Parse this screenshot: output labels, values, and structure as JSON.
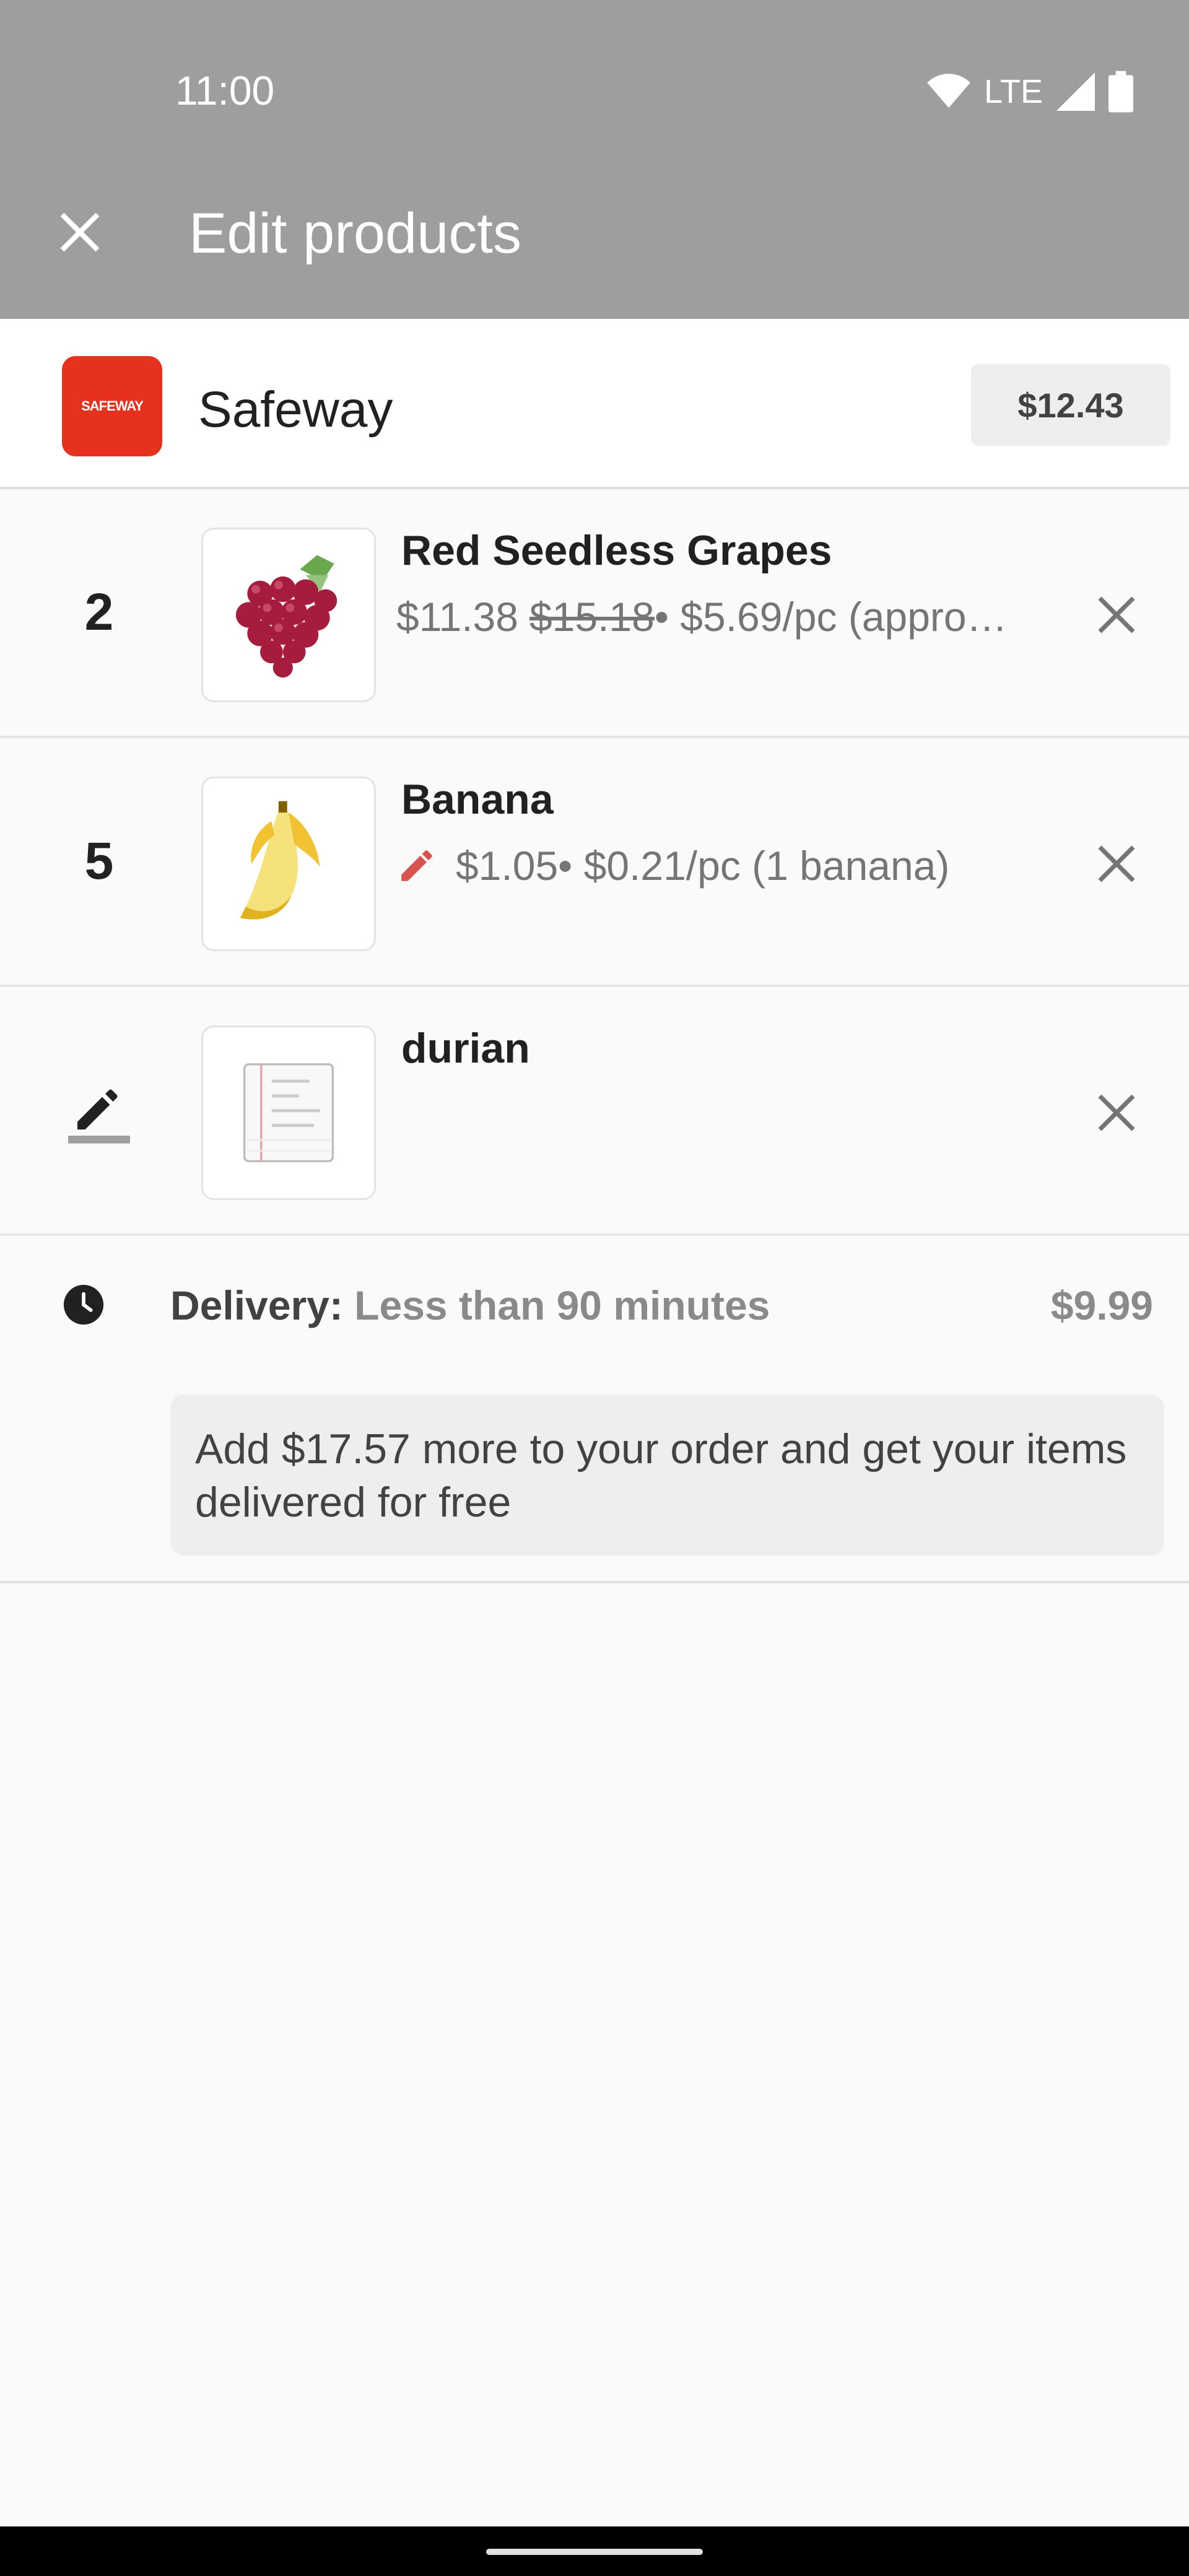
{
  "status_bar": {
    "time": "11:00",
    "network": "LTE"
  },
  "app_bar": {
    "title": "Edit products"
  },
  "store": {
    "name": "Safeway",
    "logo_text": "SAFEWAY",
    "total": "$12.43",
    "brand_color": "#e6311f"
  },
  "items": [
    {
      "quantity": "2",
      "name": "Red Seedless Grapes",
      "price": "$11.38",
      "old_price": "$15.18",
      "unit_info": " • $5.69/pc (appro…",
      "image_icon": "grapes-icon"
    },
    {
      "quantity": "5",
      "name": "Banana",
      "price": "$1.05",
      "unit_info": " • $0.21/pc (1 banana)",
      "image_icon": "banana-icon",
      "edited_icon": "pencil-icon"
    },
    {
      "quantity_icon": "edit-pencil-icon",
      "name": "durian",
      "image_icon": "notepad-icon"
    }
  ],
  "delivery": {
    "label": "Delivery:",
    "time": "Less than 90 minutes",
    "price": "$9.99",
    "icon": "clock-icon"
  },
  "promo": {
    "text": "Add $17.57 more to your order and get your items delivered for free"
  },
  "colors": {
    "app_bar": "#9e9e9e",
    "accent_red": "#d9534f"
  }
}
